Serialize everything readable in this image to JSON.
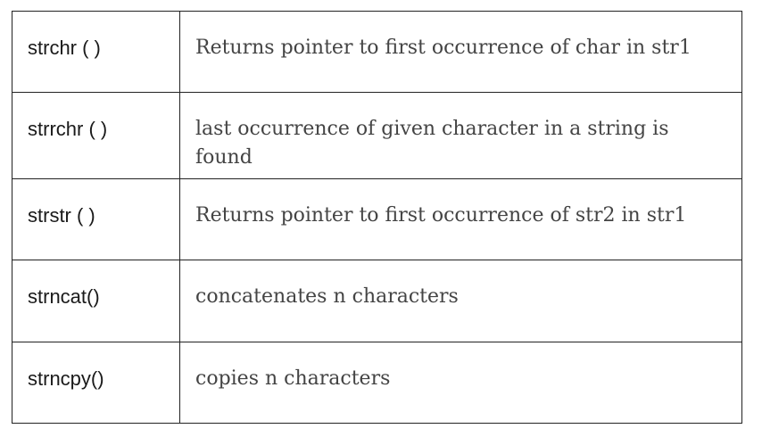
{
  "table": {
    "rows": [
      {
        "function": "strchr ( )",
        "description": "Returns pointer to first occurrence of char in str1"
      },
      {
        "function": "strrchr ( )",
        "description": "last occurrence of given character in a string is found"
      },
      {
        "function": "strstr ( )",
        "description": "Returns pointer to first occurrence of str2 in str1"
      },
      {
        "function": "strncat()",
        "description": "concatenates n characters"
      },
      {
        "function": "strncpy()",
        "description": "copies n characters"
      }
    ]
  }
}
